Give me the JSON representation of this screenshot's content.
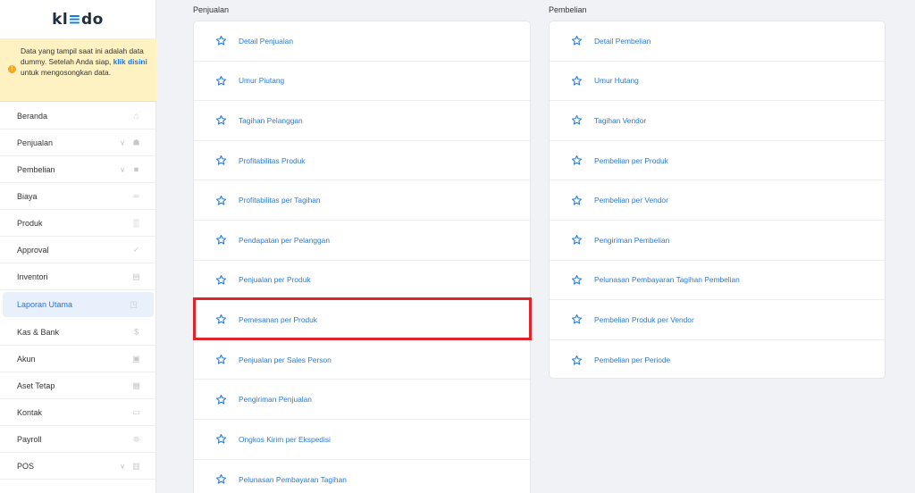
{
  "brand": {
    "logo_left": "kl",
    "logo_mid": "≡",
    "logo_right": "do"
  },
  "notice": {
    "text_before": "Data yang tampil saat ini adalah data dummy. Setelah Anda siap,",
    "link": "klik disini",
    "text_after": "untuk mengosongkan data.",
    "icon": "info-icon"
  },
  "sidebar": {
    "items": [
      {
        "label": "Beranda",
        "icon": "home-icon",
        "glyph": "⌂",
        "chevron": false,
        "active": false
      },
      {
        "label": "Penjualan",
        "icon": "shop-icon",
        "glyph": "☗",
        "chevron": true,
        "active": false
      },
      {
        "label": "Pembelian",
        "icon": "bag-icon",
        "glyph": "■",
        "chevron": true,
        "active": false
      },
      {
        "label": "Biaya",
        "icon": "card-icon",
        "glyph": "═",
        "chevron": false,
        "active": false
      },
      {
        "label": "Produk",
        "icon": "box-icon",
        "glyph": "▒",
        "chevron": false,
        "active": false
      },
      {
        "label": "Approval",
        "icon": "check-icon",
        "glyph": "✓",
        "chevron": false,
        "active": false
      },
      {
        "label": "Inventori",
        "icon": "inventory-icon",
        "glyph": "▤",
        "chevron": false,
        "active": false
      },
      {
        "label": "Laporan Utama",
        "icon": "chart-icon",
        "glyph": "◳",
        "chevron": false,
        "active": true
      },
      {
        "label": "Kas & Bank",
        "icon": "dollar-icon",
        "glyph": "$",
        "chevron": false,
        "active": false
      },
      {
        "label": "Akun",
        "icon": "ledger-icon",
        "glyph": "▣",
        "chevron": false,
        "active": false
      },
      {
        "label": "Aset Tetap",
        "icon": "building-icon",
        "glyph": "▦",
        "chevron": false,
        "active": false
      },
      {
        "label": "Kontak",
        "icon": "contact-icon",
        "glyph": "▭",
        "chevron": false,
        "active": false
      },
      {
        "label": "Payroll",
        "icon": "payroll-icon",
        "glyph": "⊚",
        "chevron": false,
        "active": false
      },
      {
        "label": "POS",
        "icon": "pos-icon",
        "glyph": "▥",
        "chevron": true,
        "active": false
      }
    ]
  },
  "penjualan": {
    "title": "Penjualan",
    "items": [
      "Detail Penjualan",
      "Umur Piutang",
      "Tagihan Pelanggan",
      "Profitabilitas Produk",
      "Profitabilitas per Tagihan",
      "Pendapatan per Pelanggan",
      "Penjualan per Produk",
      "Pemesanan per Produk",
      "Penjualan per Sales Person",
      "Pengiriman Penjualan",
      "Ongkos Kirim per Ekspedisi",
      "Pelunasan Pembayaran Tagihan"
    ],
    "highlighted_index": 7
  },
  "pembelian": {
    "title": "Pembelian",
    "items": [
      "Detail Pembelian",
      "Umur Hutang",
      "Tagihan Vendor",
      "Pembelian per Produk",
      "Pembelian per Vendor",
      "Pengiriman Pembelian",
      "Pelunasan Pembayaran Tagihan Pembelian",
      "Pembelian Produk per Vendor",
      "Pembelian per Periode"
    ]
  },
  "colors": {
    "accent": "#1677ff",
    "link": "#2a7ad6",
    "highlight": "#e0242a",
    "notice_bg": "#fff2c2"
  }
}
